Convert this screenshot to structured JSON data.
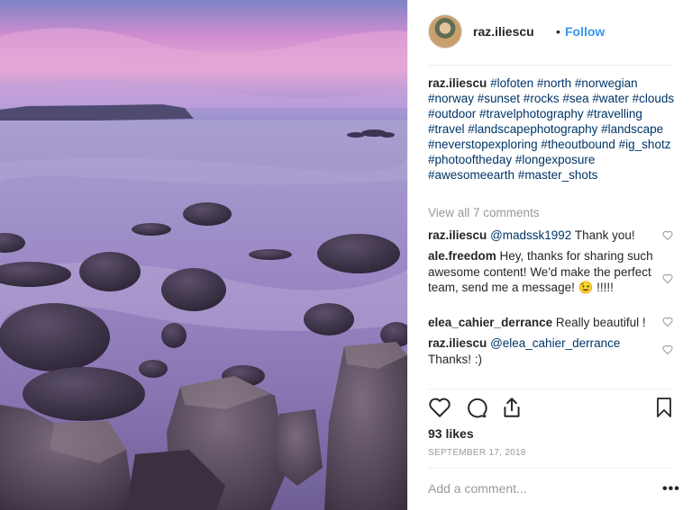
{
  "post": {
    "username": "raz.iliescu",
    "follow_label": "Follow",
    "separator": "•",
    "caption_hashtags": "#lofoten #north #norwegian #norway #sunset #rocks #sea #water #clouds #outdoor #travelphotography #travelling #travel #landscapephotography #landscape #neverstopexploring #theoutbound #ig_shotz #photooftheday #longexposure #awesomeearth #master_shots",
    "view_all_comments": "View all 7 comments",
    "comments": [
      {
        "user": "raz.iliescu",
        "mention": "@madssk1992",
        "text": " Thank you!"
      },
      {
        "user": "ale.freedom",
        "mention": "",
        "text": " Hey, thanks for sharing such awesome content! We'd make the perfect team, send me a message! 😉 !!!!!"
      },
      {
        "user": "elea_cahier_derrance",
        "mention": "",
        "text": " Really beautiful !"
      },
      {
        "user": "raz.iliescu",
        "mention": "@elea_cahier_derrance",
        "text": " Thanks! :)"
      }
    ],
    "likes": "93 likes",
    "date": "SEPTEMBER 17, 2018",
    "add_comment_placeholder": "Add a comment...",
    "more_label": "•••"
  },
  "icons": {
    "like": "heart-icon",
    "comment": "comment-icon",
    "share": "share-icon",
    "save": "bookmark-icon",
    "comment_like": "heart-small-icon",
    "more": "more-options-icon"
  },
  "colors": {
    "link": "#3897f0",
    "hashtag": "#003569",
    "muted": "#999999",
    "text": "#262626"
  }
}
